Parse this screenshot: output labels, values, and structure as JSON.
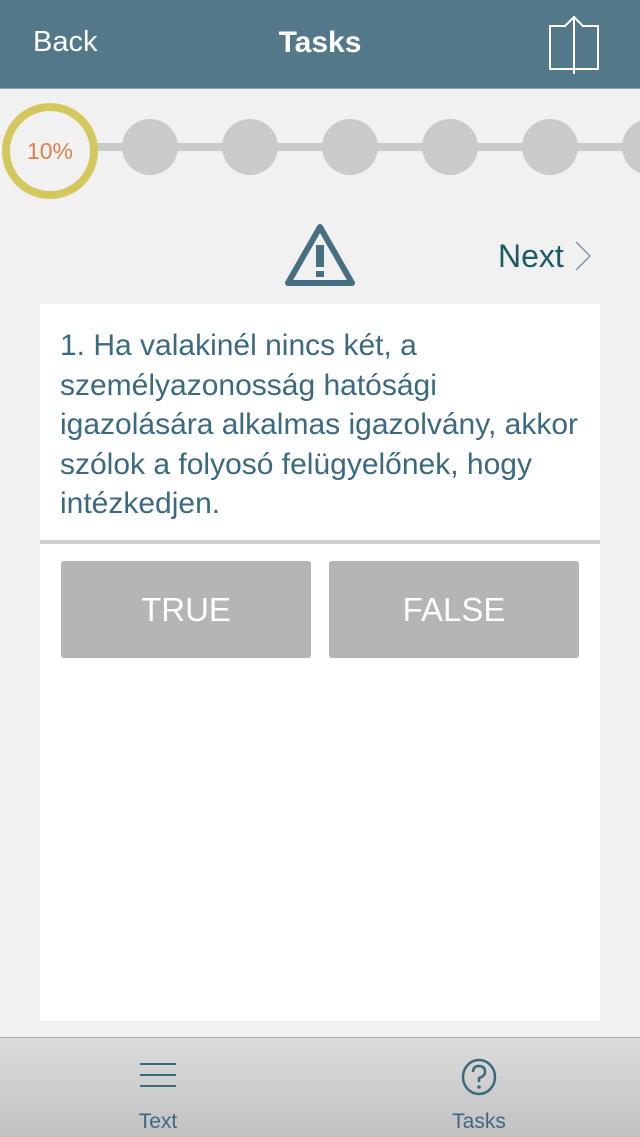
{
  "navbar": {
    "back_label": "Back",
    "title": "Tasks",
    "share_icon": "share-icon"
  },
  "progress": {
    "current_label": "10%",
    "percent": 10,
    "total_steps_visible": 7
  },
  "next": {
    "label": "Next",
    "icon": "chevron-right-icon"
  },
  "warning_icon": "warning-icon",
  "question": {
    "text": "1. Ha valakinél nincs két, a személyazonosság hatósági igazolására alkalmas igazolvány, akkor szólok a folyosó felügyelőnek, hogy intézkedjen."
  },
  "answers": [
    {
      "label": "TRUE"
    },
    {
      "label": "FALSE"
    }
  ],
  "tabbar": {
    "items": [
      {
        "label": "Text",
        "icon": "menu-icon"
      },
      {
        "label": "Tasks",
        "icon": "help-circle-icon"
      }
    ]
  },
  "colors": {
    "navbar": "#53788a",
    "accent_text": "#3b6a80",
    "next_text": "#1b5b63",
    "progress_ring": "#d3c85e",
    "progress_text": "#e07f4c",
    "step_inactive": "#cacaca",
    "answer_button": "#b5b5b5"
  }
}
